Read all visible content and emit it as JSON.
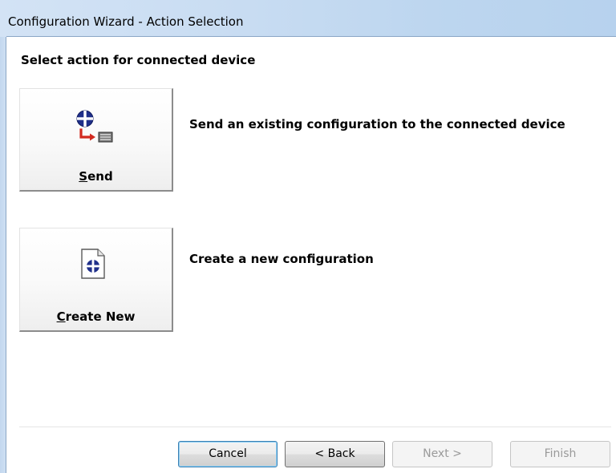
{
  "window": {
    "title": "Configuration Wizard - Action Selection"
  },
  "main": {
    "heading": "Select action for connected device",
    "actions": [
      {
        "label_mnemonic": "S",
        "label_rest": "end",
        "description": "Send an existing configuration to the connected device",
        "icon": "send-configuration-icon"
      },
      {
        "label_mnemonic": "C",
        "label_rest": "reate New",
        "description": "Create a new configuration",
        "icon": "new-configuration-document-icon"
      }
    ]
  },
  "footer": {
    "cancel_label": "Cancel",
    "back_label": "< Back",
    "next_label": "Next >",
    "finish_label": "Finish"
  },
  "colors": {
    "titlebar": "#c8dcf2",
    "icon_blue": "#1f2f8a",
    "arrow_red": "#d22a1f",
    "disabled_text": "#9a9a9a"
  }
}
